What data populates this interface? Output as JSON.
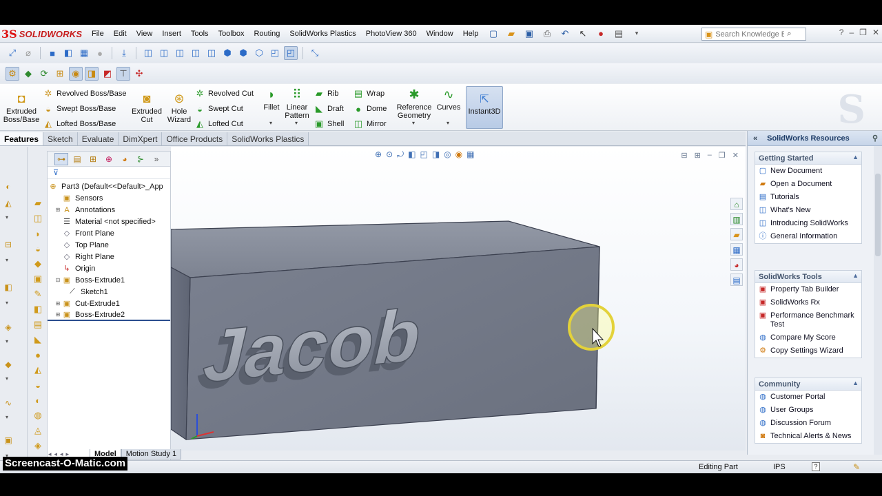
{
  "app": {
    "brand": "SOLIDWORKS",
    "ds_mark": "3S"
  },
  "menus": [
    "File",
    "Edit",
    "View",
    "Insert",
    "Tools",
    "Toolbox",
    "Routing",
    "SolidWorks Plastics",
    "PhotoView 360",
    "Window",
    "Help"
  ],
  "search": {
    "placeholder": "Search Knowledge Base"
  },
  "commandmanager": {
    "extruded_boss": "Extruded Boss/Base",
    "revolved_boss": "Revolved Boss/Base",
    "swept_boss": "Swept Boss/Base",
    "lofted_boss": "Lofted Boss/Base",
    "extruded_cut": "Extruded Cut",
    "hole_wizard": "Hole Wizard",
    "revolved_cut": "Revolved Cut",
    "swept_cut": "Swept Cut",
    "lofted_cut": "Lofted Cut",
    "fillet": "Fillet",
    "linear_pattern": "Linear Pattern",
    "rib": "Rib",
    "draft": "Draft",
    "shell": "Shell",
    "wrap": "Wrap",
    "dome": "Dome",
    "mirror": "Mirror",
    "reference_geometry": "Reference Geometry",
    "curves": "Curves",
    "instant3d": "Instant3D"
  },
  "tabs": [
    "Features",
    "Sketch",
    "Evaluate",
    "DimXpert",
    "Office Products",
    "SolidWorks Plastics"
  ],
  "tree": {
    "root": "Part3  (Default<<Default>_App",
    "items": [
      {
        "label": "Sensors",
        "icon": "sensor-icon"
      },
      {
        "label": "Annotations",
        "icon": "annotations-icon"
      },
      {
        "label": "Material <not specified>",
        "icon": "material-icon"
      },
      {
        "label": "Front Plane",
        "icon": "plane-icon"
      },
      {
        "label": "Top Plane",
        "icon": "plane-icon"
      },
      {
        "label": "Right Plane",
        "icon": "plane-icon"
      },
      {
        "label": "Origin",
        "icon": "origin-icon"
      },
      {
        "label": "Boss-Extrude1",
        "icon": "extrude-icon"
      },
      {
        "label": "Sketch1",
        "icon": "sketch-icon"
      },
      {
        "label": "Cut-Extrude1",
        "icon": "cut-extrude-icon"
      },
      {
        "label": "Boss-Extrude2",
        "icon": "extrude-icon"
      }
    ]
  },
  "model": {
    "text": "Jacob"
  },
  "bottom_tabs": [
    "Model",
    "Motion Study 1"
  ],
  "resources": {
    "title": "SolidWorks Resources",
    "getting_started": {
      "title": "Getting Started",
      "items": [
        "New Document",
        "Open a Document",
        "Tutorials",
        "What's New",
        "Introducing SolidWorks",
        "General Information"
      ]
    },
    "tools": {
      "title": "SolidWorks Tools",
      "items": [
        "Property Tab Builder",
        "SolidWorks Rx",
        "Performance Benchmark Test",
        "Compare My Score",
        "Copy Settings Wizard"
      ]
    },
    "community": {
      "title": "Community",
      "items": [
        "Customer Portal",
        "User Groups",
        "Discussion Forum",
        "Technical Alerts & News"
      ]
    }
  },
  "status": {
    "mode": "Editing Part",
    "units": "IPS"
  },
  "watermark": "Screencast-O-Matic.com"
}
